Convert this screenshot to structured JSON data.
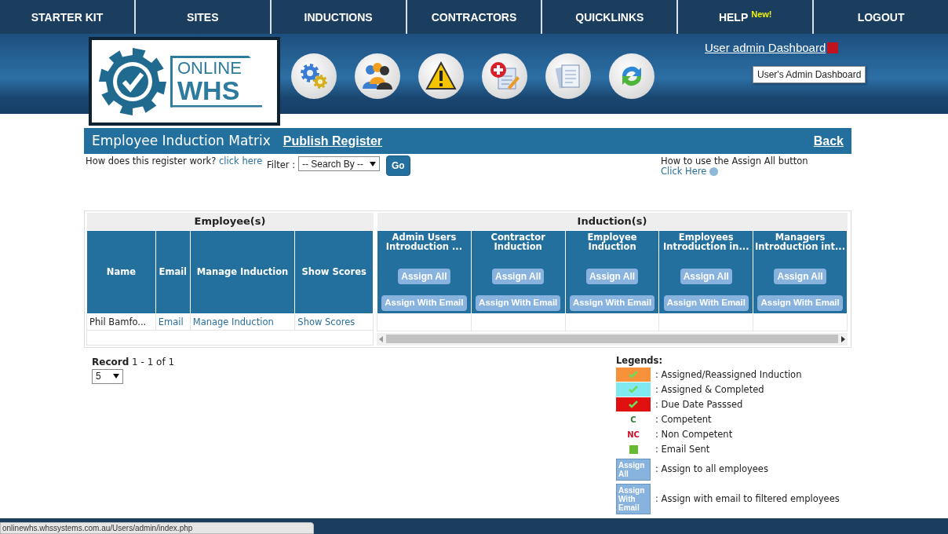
{
  "nav": [
    {
      "label": "STARTER KIT"
    },
    {
      "label": "SITES"
    },
    {
      "label": "INDUCTIONS"
    },
    {
      "label": "CONTRACTORS"
    },
    {
      "label": "QUICKLINKS"
    },
    {
      "label": "HELP",
      "badge": "New!"
    },
    {
      "label": "LOGOUT"
    }
  ],
  "logo": {
    "line1": "ONLINE",
    "line2": "WHS"
  },
  "dashboard_link": "User admin Dashboard",
  "tooltip": "User's Admin Dashboard",
  "title_bar": {
    "title": "Employee Induction Matrix",
    "publish": "Publish Register",
    "back": "Back"
  },
  "help_left": {
    "text": "How does this register work?",
    "link": "click here"
  },
  "filter": {
    "label": "Filter :",
    "value": "-- Search By --",
    "button": "Go"
  },
  "help_right": {
    "text": "How to use the Assign All button",
    "link": "Click Here"
  },
  "employees": {
    "heading": "Employee(s)",
    "columns": [
      "Name",
      "Email",
      "Manage Induction",
      "Show Scores"
    ],
    "rows": [
      {
        "name": "Phil Bamfo...",
        "email": "Email",
        "manage": "Manage Induction",
        "scores": "Show Scores"
      }
    ]
  },
  "inductions": {
    "heading": "Induction(s)",
    "columns": [
      {
        "title": "Admin Users Introduction ...",
        "assign_all": "Assign All",
        "assign_email": "Assign With Email"
      },
      {
        "title": "Contractor Induction",
        "assign_all": "Assign All",
        "assign_email": "Assign With Email"
      },
      {
        "title": "Employee Induction",
        "assign_all": "Assign All",
        "assign_email": "Assign With Email"
      },
      {
        "title": "Employees Introduction in...",
        "assign_all": "Assign All",
        "assign_email": "Assign With Email"
      },
      {
        "title": "Managers Introduction int...",
        "assign_all": "Assign All",
        "assign_email": "Assign With Email"
      }
    ]
  },
  "record": "**Record** 1 - 1 of 1",
  "page_size": "5",
  "legend": {
    "title": "Legends:",
    "items": [
      {
        "kind": "swatch",
        "color": "#f7923a",
        "text": ": Assigned/Reassigned Induction"
      },
      {
        "kind": "swatch",
        "color": "#7fe8f0",
        "text": ": Assigned & Completed"
      },
      {
        "kind": "swatch",
        "color": "#e01010",
        "text": ": Due Date Passsed"
      },
      {
        "kind": "code",
        "code": "C",
        "color": "#2e7d32",
        "text": ": Competent"
      },
      {
        "kind": "code",
        "code": "NC",
        "color": "#d0102a",
        "text": ": Non Competent"
      },
      {
        "kind": "square",
        "color": "#66bb33",
        "text": ": Email Sent"
      },
      {
        "kind": "button",
        "label": "Assign All",
        "text": ": Assign to all employees"
      },
      {
        "kind": "button",
        "label": "Assign With Email",
        "text": ": Assign with email to filtered employees"
      }
    ]
  },
  "status_url": "onlinewhs.whssystems.com.au/Users/admin/index.php"
}
